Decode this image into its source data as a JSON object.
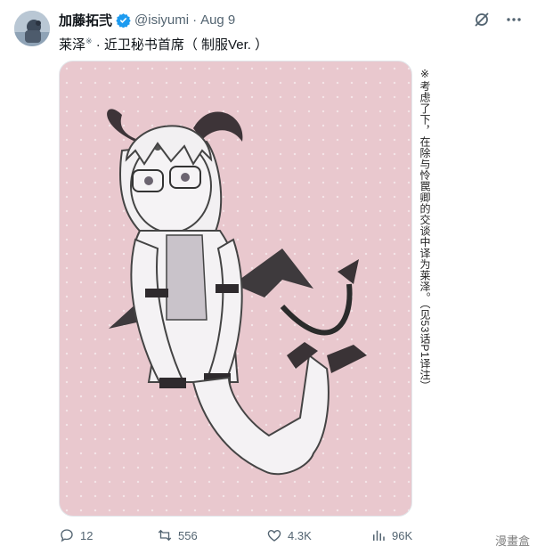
{
  "tweet": {
    "author_name": "加藤拓弐",
    "handle": "@isiyumi",
    "separator": "·",
    "date": "Aug 9",
    "text_main": "莱泽",
    "text_mark": "※",
    "text_rest": " · 近卫秘书首席（ 制服Ver. ）"
  },
  "side_note": "※考虑了下，在除与怜罠卿的交谈中译为莱泽。（见53话P1译注）",
  "stats": {
    "replies": "12",
    "reposts": "556",
    "likes": "4.3K",
    "views": "96K"
  },
  "watermark": "漫畫盒",
  "colors": {
    "media_bg": "#e9c8ce",
    "verified": "#1d9bf0",
    "meta_gray": "#536471"
  },
  "icons": {
    "verified": "verified-badge-icon",
    "grok": "grok-icon",
    "more": "more-icon",
    "reply": "reply-icon",
    "repost": "repost-icon",
    "like": "heart-icon",
    "views": "views-icon"
  }
}
